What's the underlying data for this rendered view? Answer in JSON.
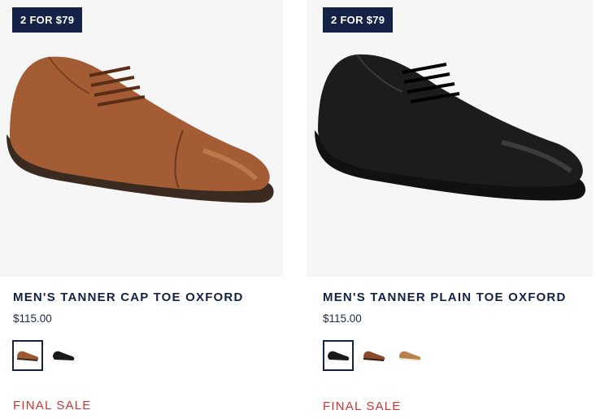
{
  "products": [
    {
      "badge": "2 FOR $79",
      "title": "MEN'S TANNER CAP TOE OXFORD",
      "price": "$115.00",
      "sale_label": "FINAL SALE",
      "swatches": [
        {
          "color": "#9b5a34",
          "selected": true
        },
        {
          "color": "#1a1a1a",
          "selected": false
        }
      ],
      "shoe_color": "#a35c33"
    },
    {
      "badge": "2 FOR $79",
      "title": "MEN'S TANNER PLAIN TOE OXFORD",
      "price": "$115.00",
      "sale_label": "FINAL SALE",
      "swatches": [
        {
          "color": "#1a1a1a",
          "selected": true
        },
        {
          "color": "#8a4a2a",
          "selected": false
        },
        {
          "color": "#b8804a",
          "selected": false
        }
      ],
      "shoe_color": "#1c1c1c"
    }
  ],
  "colors": {
    "badge_bg": "#132246",
    "sale_text": "#d6332f",
    "image_bg": "#f6f6f6"
  }
}
